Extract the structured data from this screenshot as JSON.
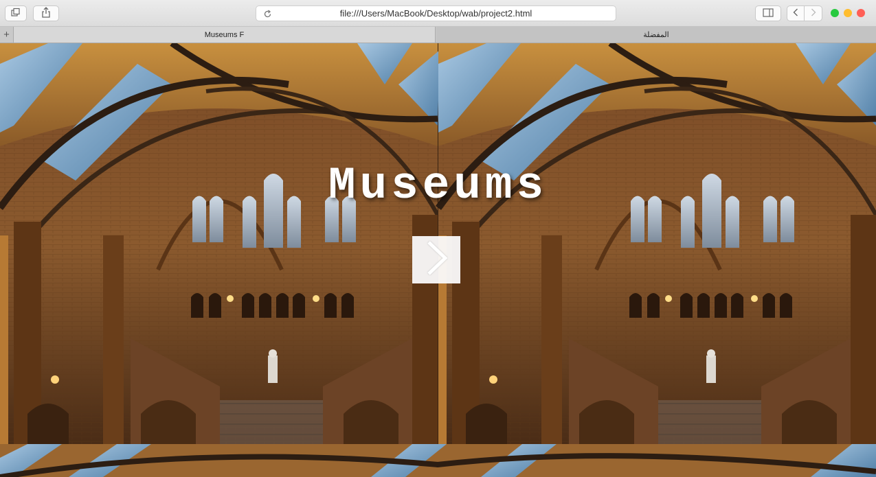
{
  "toolbar": {
    "address_url": "file:///Users/MacBook/Desktop/wab/project2.html",
    "buttons": {
      "tab_overview_icon": "tabs-icon",
      "share_icon": "share-icon",
      "sidebar_icon": "sidebar-icon",
      "back_icon": "chevron-left-icon",
      "forward_icon": "chevron-right-icon",
      "reload_icon": "reload-icon"
    },
    "traffic_lights": [
      "#27c93f",
      "#ffbd2e",
      "#ff5f56"
    ]
  },
  "tabs": [
    {
      "label": "Museums F",
      "active": true
    },
    {
      "label": "المفضلة",
      "active": false
    }
  ],
  "page": {
    "title": "Museums",
    "next_button_icon": "chevron-right-icon",
    "background_image": "museum-hall-interior"
  }
}
